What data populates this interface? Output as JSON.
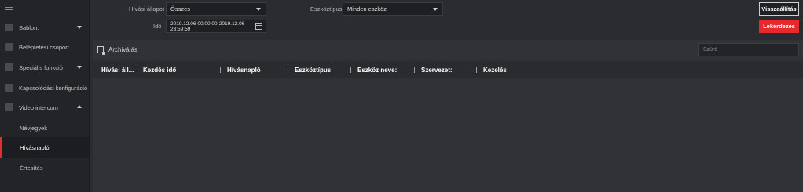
{
  "sidebar": {
    "items": [
      {
        "label": "Sablon:",
        "icon": "template-icon",
        "expandable": true,
        "expanded": false
      },
      {
        "label": "Beléptetési csoport",
        "icon": "access-group-icon",
        "expandable": false
      },
      {
        "label": "Speciális funkció",
        "icon": "special-function-icon",
        "expandable": true,
        "expanded": false
      },
      {
        "label": "Kapcsolódási konfiguráció",
        "icon": "linkage-config-icon",
        "expandable": false
      },
      {
        "label": "Video intercom",
        "icon": "video-intercom-icon",
        "expandable": true,
        "expanded": true
      }
    ],
    "subitems": [
      {
        "label": "Névjegyek",
        "active": false
      },
      {
        "label": "Hívásnapló",
        "active": true
      },
      {
        "label": "Értesítés",
        "active": false
      }
    ]
  },
  "filters": {
    "call_status_label": "Hívási állapot",
    "call_status_value": "Összes",
    "device_type_label": "Eszköztípus",
    "device_type_value": "Minden eszköz",
    "time_label": "Idő",
    "time_value": "2019.12.06 00:00:00-2019.12.06 23:59:59"
  },
  "actions": {
    "reset_label": "Visszaállítás",
    "query_label": "Lekérdezés"
  },
  "panel": {
    "archive_label": "Archiválás",
    "filter_placeholder": "Szűrő"
  },
  "table": {
    "columns": [
      "Hívási áll...",
      "Kezdés idő",
      "Hívásnapló",
      "Eszköztípus",
      "Eszköz neve:",
      "Szervezet:",
      "Kezelés"
    ],
    "rows": []
  },
  "colors": {
    "accent_red": "#e7282d",
    "background": "#2b2c30",
    "sidebar": "#232427"
  }
}
